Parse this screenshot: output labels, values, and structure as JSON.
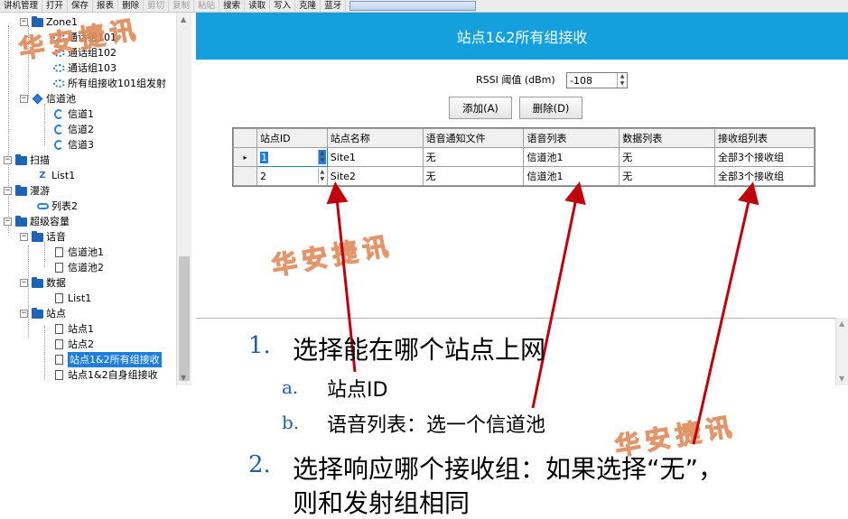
{
  "toolbar": {
    "items": [
      {
        "label": "讲机管理",
        "enabled": true
      },
      {
        "label": "打开",
        "enabled": true
      },
      {
        "label": "保存",
        "enabled": true
      },
      {
        "label": "报表",
        "enabled": true
      },
      {
        "label": "删除",
        "enabled": true
      },
      {
        "label": "剪切",
        "enabled": false
      },
      {
        "label": "复制",
        "enabled": false
      },
      {
        "label": "粘贴",
        "enabled": false
      },
      {
        "label": "搜索",
        "enabled": true
      },
      {
        "label": "读取",
        "enabled": true
      },
      {
        "label": "写入",
        "enabled": true
      },
      {
        "label": "克隆",
        "enabled": true
      },
      {
        "label": "蓝牙",
        "enabled": true
      }
    ]
  },
  "tree": {
    "zone": "Zone1",
    "zone_items": [
      "通话组101",
      "通话组102",
      "通话组103",
      "所有组接收101组发射"
    ],
    "pool": "信道池",
    "pool_items": [
      "信道1",
      "信道2",
      "信道3"
    ],
    "scan": "扫描",
    "scan_items": [
      "List1"
    ],
    "roam": "漫游",
    "roam_items": [
      "列表2"
    ],
    "capacity": "超级容量",
    "voice": "话音",
    "voice_items": [
      "信道池1",
      "信道池2"
    ],
    "data": "数据",
    "data_items": [
      "List1"
    ],
    "site": "站点",
    "site_items": [
      "站点1",
      "站点2",
      "站点1&2所有组接收",
      "站点1&2自身组接收"
    ],
    "selected": "站点1&2所有组接收"
  },
  "panel": {
    "title": "站点1&2所有组接收",
    "rssi_label": "RSSI 阈值 (dBm)",
    "rssi_value": "-108",
    "add_button": "添加(A)",
    "delete_button": "删除(D)"
  },
  "grid": {
    "columns": [
      "站点ID",
      "站点名称",
      "语音通知文件",
      "语音列表",
      "数据列表",
      "接收组列表"
    ],
    "rows": [
      [
        "1",
        "Site1",
        "无",
        "信道池1",
        "无",
        "全部3个接收组"
      ],
      [
        "2",
        "Site2",
        "无",
        "信道池1",
        "无",
        "全部3个接收组"
      ]
    ],
    "current_row_marker": "▸"
  },
  "notes": {
    "item1_num": "1.",
    "item1_text": "选择能在哪个站点上网",
    "item1a_num": "a.",
    "item1a_text": "站点ID",
    "item1b_num": "b.",
    "item1b_text": "语音列表：选一个信道池",
    "item2_num": "2.",
    "item2_text_line1": "选择响应哪个接收组：如果选择“无”，",
    "item2_text_line2": "则和发射组相同"
  },
  "watermark": "华安捷讯",
  "colors": {
    "header": "#14a0dc",
    "selection": "#1e7ee0",
    "arrow": "#c0000b",
    "note_number": "#1f5fa8",
    "watermark_outline": "#e08a5a"
  }
}
